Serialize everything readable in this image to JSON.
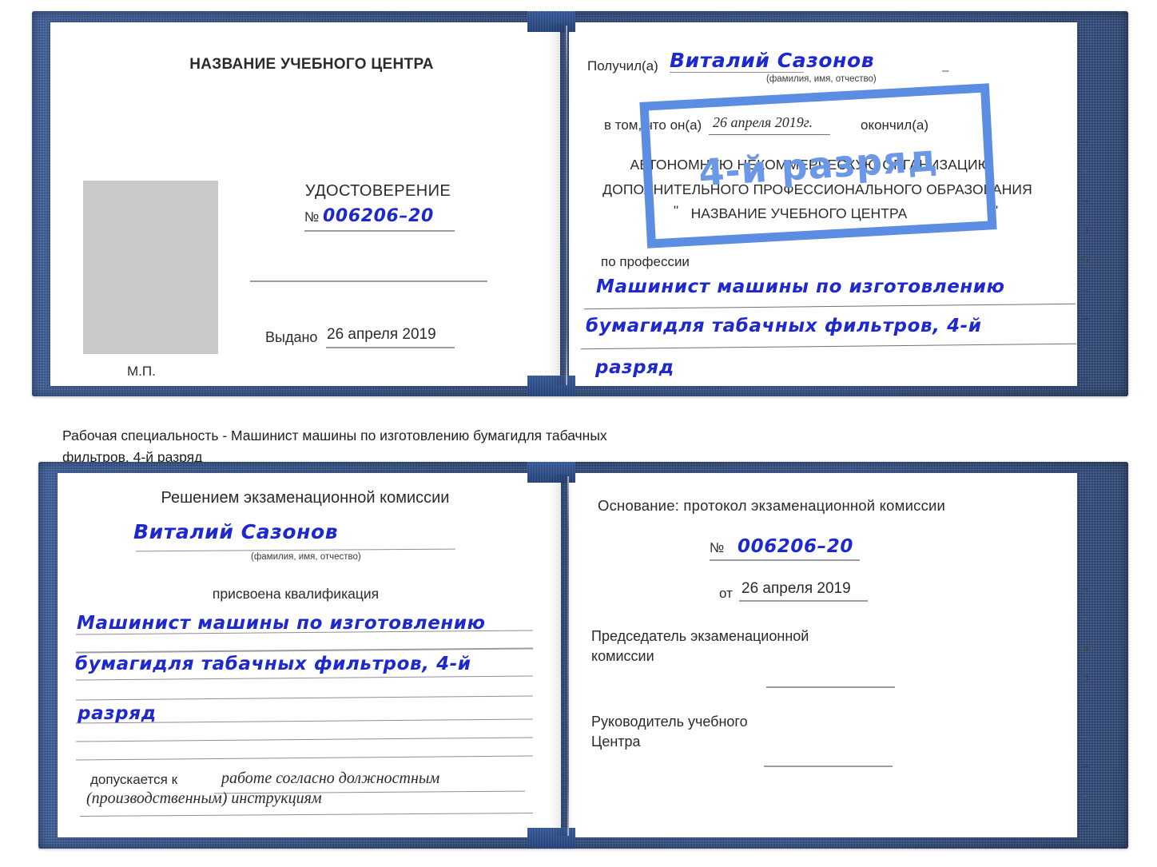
{
  "caption": {
    "line1": "Рабочая специальность - Машинист машины по изготовлению бумагидля табачных",
    "line2": "фильтров, 4-й разряд"
  },
  "colors": {
    "cover_blue": "#2a4d93",
    "ink_blue": "#1d28cf",
    "stamp_blue": "#5b8de2",
    "rule_gray": "#8e9095",
    "photo_gray": "#c9c9c9"
  },
  "top_booklet": {
    "left_page": {
      "header": "НАЗВАНИЕ УЧЕБНОГО ЦЕНТРА",
      "doc_title": "УДОСТОВЕРЕНИЕ",
      "number_prefix": "№",
      "number_value": "006206–20",
      "issued_label": "Выдано",
      "issued_value": "26 апреля 2019",
      "seal_label": "М.П.",
      "photo_placeholder": "photo-placeholder"
    },
    "right_page": {
      "received_label": "Получил(а)",
      "received_value": "Виталий Сазонов",
      "name_hint": "(фамилия, имя, отчество)",
      "in_that_label": "в том, что он(а)",
      "completion_date": "26 апреля 2019г.",
      "finished_label": "окончил(а)",
      "org_line1": "АВТОНОМНУЮ НЕКОММЕРЧЕСКУЮ ОРГАНИЗАЦИЮ",
      "org_line2": "ДОПОЛНИТЕЛЬНОГО ПРОФЕССИОНАЛЬНОГО ОБРАЗОВАНИЯ",
      "org_quote_open": "\"",
      "org_line3": "НАЗВАНИЕ УЧЕБНОГО ЦЕНТРА",
      "org_quote_close": "\"",
      "profession_label": "по профессии",
      "profession_line1": "Машинист машины по изготовлению",
      "profession_line2": "бумагидля табачных фильтров, 4-й",
      "profession_line3": "разряд",
      "stamp_text": "4-й разряд",
      "edge_column": [
        "–",
        "–",
        "–",
        "и",
        "а",
        "←",
        "–",
        "–",
        "–",
        "–"
      ]
    }
  },
  "bottom_booklet": {
    "left_page": {
      "header": "Решением экзаменационной комиссии",
      "name_value": "Виталий Сазонов",
      "name_hint": "(фамилия, имя, отчество)",
      "qualification_label": "присвоена квалификация",
      "qual_line1": "Машинист машины по изготовлению",
      "qual_line2": "бумагидля табачных фильтров, 4-й",
      "qual_line3": "разряд",
      "admitted_label": "допускается к",
      "admitted_value_line1": "работе согласно должностным",
      "admitted_value_line2": "(производственным) инструкциям"
    },
    "right_page": {
      "basis_label": "Основание: протокол экзаменационной комиссии",
      "number_prefix": "№",
      "number_value": "006206–20",
      "from_label": "от",
      "from_value": "26 апреля 2019",
      "chairman_line1": "Председатель экзаменационной",
      "chairman_line2": "комиссии",
      "head_line1": "Руководитель учебного",
      "head_line2": "Центра",
      "edge_column": [
        "–",
        "–",
        "и",
        "а",
        "←",
        "–",
        "–",
        "–",
        "–"
      ]
    }
  }
}
